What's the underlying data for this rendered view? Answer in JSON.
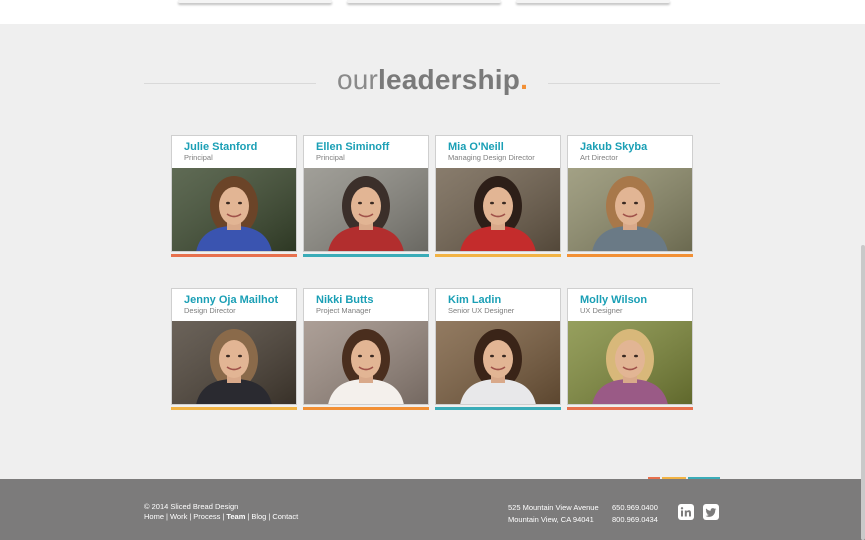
{
  "heading": {
    "light": "our",
    "bold": "leadership",
    "dot": "."
  },
  "team": [
    {
      "name": "Julie Stanford",
      "role": "Principal",
      "bar_color": "#e8704d",
      "photo_bg": "#3c4a2f",
      "hair": "#6b4428",
      "shirt": "#3a54b0"
    },
    {
      "name": "Ellen Siminoff",
      "role": "Principal",
      "bar_color": "#3aacb8",
      "photo_bg": "#8c8a82",
      "hair": "#3b2f2a",
      "shirt": "#b22e2e"
    },
    {
      "name": "Mia O'Neill",
      "role": "Managing Design Director",
      "bar_color": "#f2b344",
      "photo_bg": "#6e5f4c",
      "hair": "#2d1f18",
      "shirt": "#c42c2c"
    },
    {
      "name": "Jakub Skyba",
      "role": "Art Director",
      "bar_color": "#f29035",
      "photo_bg": "#8e8c6a",
      "hair": "#a8784a",
      "shirt": "#6a7a86"
    },
    {
      "name": "Jenny Oja Mailhot",
      "role": "Design Director",
      "bar_color": "#f2b344",
      "photo_bg": "#4a4035",
      "hair": "#8a6a4a",
      "shirt": "#2a2a30"
    },
    {
      "name": "Nikki Butts",
      "role": "Project Manager",
      "bar_color": "#f29035",
      "photo_bg": "#9a8a80",
      "hair": "#4a2e1e",
      "shirt": "#f4f0ec"
    },
    {
      "name": "Kim Ladin",
      "role": "Senior UX Designer",
      "bar_color": "#3aacb8",
      "photo_bg": "#7a5d3e",
      "hair": "#3a2418",
      "shirt": "#e8e8ea"
    },
    {
      "name": "Molly Wilson",
      "role": "UX Designer",
      "bar_color": "#e8704d",
      "photo_bg": "#7f8a3a",
      "hair": "#d8b87a",
      "shirt": "#9a5a86"
    }
  ],
  "footer": {
    "copyright": "© 2014 Sliced Bread Design",
    "nav": [
      "Home",
      "Work",
      "Process",
      "Team",
      "Blog",
      "Contact"
    ],
    "active_nav": "Team",
    "address_line1": "525 Mountain View Avenue",
    "address_line2": "Mountain View, CA 94041",
    "phone1": "650.969.0400",
    "phone2": "800.969.0434",
    "social_icons": [
      "linkedin-icon",
      "twitter-icon"
    ],
    "accent_colors": [
      "#e8704d",
      "#f2b344",
      "#3aacb8"
    ]
  }
}
